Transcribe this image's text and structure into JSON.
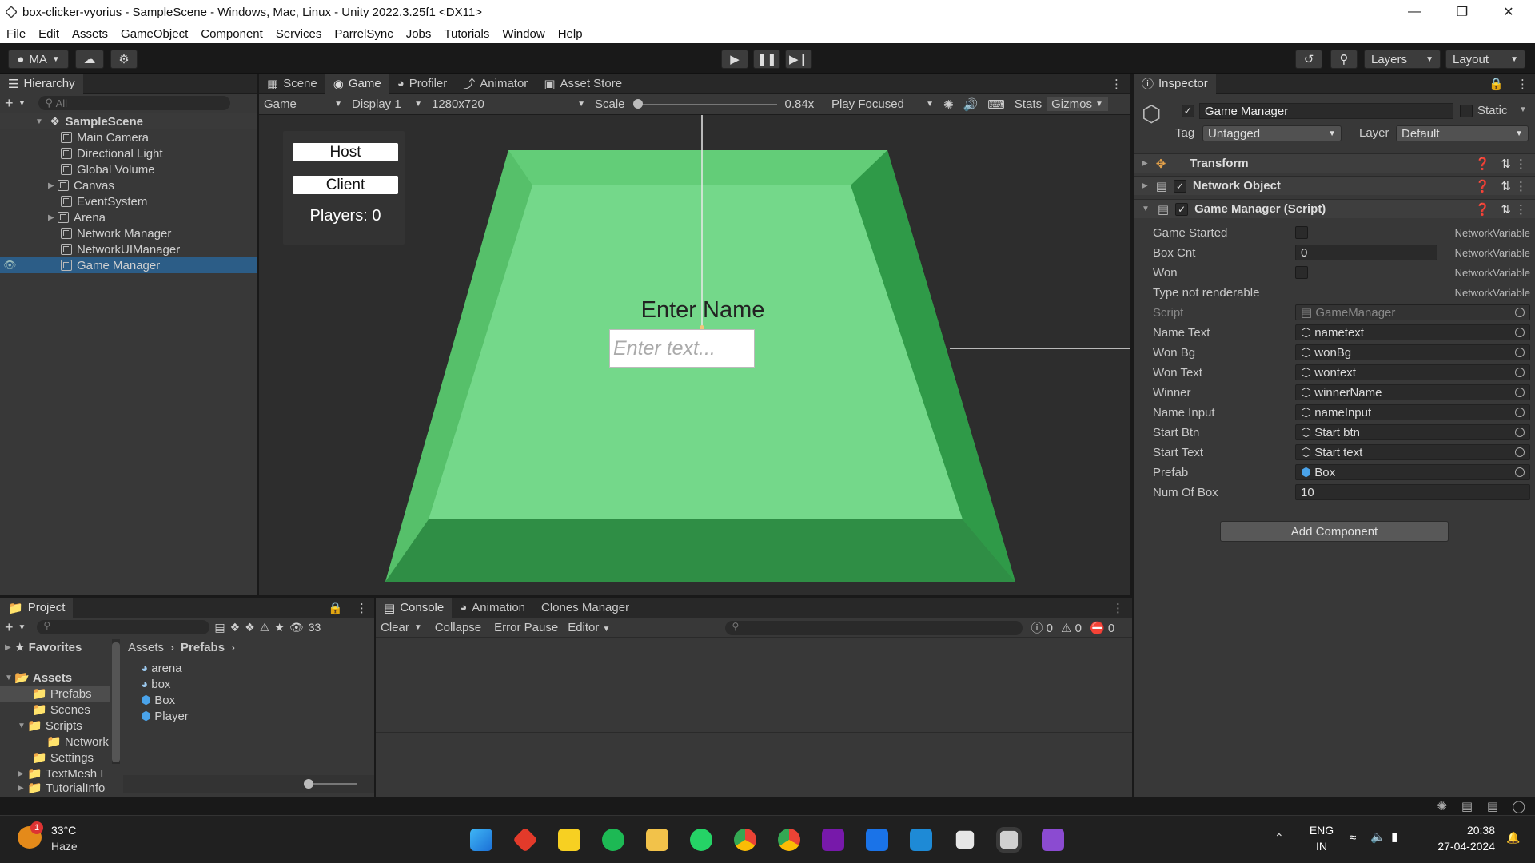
{
  "window": {
    "title": "box-clicker-vyorius - SampleScene - Windows, Mac, Linux - Unity 2022.3.25f1 <DX11>"
  },
  "menu": [
    "File",
    "Edit",
    "Assets",
    "GameObject",
    "Component",
    "Services",
    "ParrelSync",
    "Jobs",
    "Tutorials",
    "Window",
    "Help"
  ],
  "toolbar": {
    "account": "MA",
    "layers": "Layers",
    "layout": "Layout"
  },
  "hierarchy": {
    "tab": "Hierarchy",
    "search_placeholder": "All",
    "scene": "SampleScene",
    "items": [
      "Main Camera",
      "Directional Light",
      "Global Volume",
      "Canvas",
      "EventSystem",
      "Arena",
      "Network Manager",
      "NetworkUIManager",
      "Game Manager"
    ],
    "selected": "Game Manager"
  },
  "center_tabs": [
    "Scene",
    "Game",
    "Profiler",
    "Animator",
    "Asset Store"
  ],
  "game_toolbar": {
    "view": "Game",
    "display": "Display 1",
    "resolution": "1280x720",
    "scale_label": "Scale",
    "scale_value": "0.84x",
    "play_mode": "Play Focused",
    "stats": "Stats",
    "gizmos": "Gizmos"
  },
  "game_view": {
    "host": "Host",
    "client": "Client",
    "players": "Players: 0",
    "enter_name": "Enter Name",
    "input_placeholder": "Enter text..."
  },
  "inspector": {
    "tab": "Inspector",
    "object_name": "Game Manager",
    "static_label": "Static",
    "tag_label": "Tag",
    "tag_value": "Untagged",
    "layer_label": "Layer",
    "layer_value": "Default",
    "components": [
      "Transform",
      "Network Object",
      "Game Manager (Script)"
    ],
    "fields": [
      {
        "label": "Game Started",
        "type": "check",
        "note": "NetworkVariable"
      },
      {
        "label": "Box Cnt",
        "type": "text",
        "value": "0",
        "note": "NetworkVariable"
      },
      {
        "label": "Won",
        "type": "check",
        "note": "NetworkVariable"
      },
      {
        "label": "Type not renderable",
        "type": "none",
        "note": "NetworkVariable"
      },
      {
        "label": "Script",
        "type": "ref",
        "value": "GameManager"
      },
      {
        "label": "Name Text",
        "type": "ref",
        "value": "nametext"
      },
      {
        "label": "Won Bg",
        "type": "ref",
        "value": "wonBg"
      },
      {
        "label": "Won Text",
        "type": "ref",
        "value": "wontext"
      },
      {
        "label": "Winner",
        "type": "ref",
        "value": "winnerName"
      },
      {
        "label": "Name Input",
        "type": "ref",
        "value": "nameInput"
      },
      {
        "label": "Start Btn",
        "type": "ref",
        "value": "Start btn"
      },
      {
        "label": "Start Text",
        "type": "ref",
        "value": "Start text"
      },
      {
        "label": "Prefab",
        "type": "ref",
        "value": "Box"
      },
      {
        "label": "Num Of Box",
        "type": "text",
        "value": "10"
      }
    ],
    "add_component": "Add Component"
  },
  "project": {
    "tab": "Project",
    "hidden_count": "33",
    "favorites": "Favorites",
    "assets": "Assets",
    "folders": [
      "Prefabs",
      "Scenes",
      "Scripts",
      "Network",
      "Settings",
      "TextMesh I",
      "TutorialInfo"
    ],
    "breadcrumb": [
      "Assets",
      "Prefabs"
    ],
    "files": [
      "arena",
      "box",
      "Box",
      "Player"
    ]
  },
  "console": {
    "tabs": [
      "Console",
      "Animation",
      "Clones Manager"
    ],
    "clear": "Clear",
    "collapse": "Collapse",
    "error_pause": "Error Pause",
    "editor": "Editor",
    "counts": [
      "0",
      "0",
      "0"
    ]
  },
  "taskbar": {
    "weather_temp": "33°C",
    "weather_desc": "Haze",
    "weather_badge": "1",
    "lang1": "ENG",
    "lang2": "IN",
    "time": "20:38",
    "date": "27-04-2024"
  }
}
